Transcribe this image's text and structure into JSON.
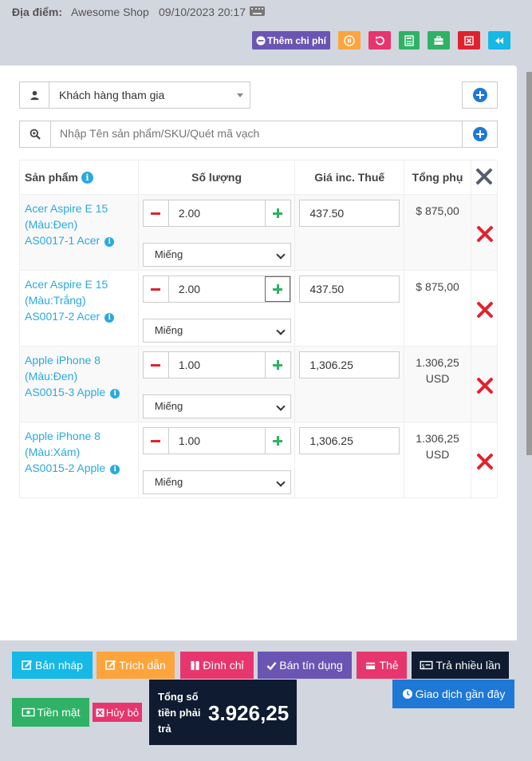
{
  "header": {
    "location_label": "Địa điểm:",
    "shop_name": "Awesome Shop",
    "datetime": "09/10/2023 20:17",
    "add_expense_label": "Thêm chi phí"
  },
  "customer": {
    "selected": "Khách hàng tham gia"
  },
  "search": {
    "placeholder": "Nhập Tên sản phẩm/SKU/Quét mã vạch"
  },
  "table": {
    "headers": {
      "product": "Sản phẩm",
      "quantity": "Số lượng",
      "price": "Giá inc. Thuế",
      "subtotal": "Tổng phụ"
    },
    "rows": [
      {
        "line1": "Acer Aspire E 15",
        "line2": "(Màu:Đen)",
        "line3": "AS0017-1 Acer",
        "qty": "2.00",
        "unit": "Miếng",
        "price": "437.50",
        "subtotal1": "$ 875,00",
        "subtotal2": ""
      },
      {
        "line1": "Acer Aspire E 15",
        "line2": "(Màu:Trắng)",
        "line3": "AS0017-2 Acer",
        "qty": "2.00",
        "unit": "Miếng",
        "price": "437.50",
        "subtotal1": "$ 875,00",
        "subtotal2": ""
      },
      {
        "line1": "Apple iPhone 8",
        "line2": "(Màu:Đen)",
        "line3": "AS0015-3 Apple",
        "qty": "1.00",
        "unit": "Miếng",
        "price": "1,306.25",
        "subtotal1": "1.306,25",
        "subtotal2": "USD"
      },
      {
        "line1": "Apple iPhone 8",
        "line2": "(Màu:Xám)",
        "line3": "AS0015-2 Apple",
        "qty": "1.00",
        "unit": "Miếng",
        "price": "1,306.25",
        "subtotal1": "1.306,25",
        "subtotal2": "USD"
      }
    ]
  },
  "footer": {
    "draft": "Bản nháp",
    "quote": "Trích dẫn",
    "suspend": "Đình chỉ",
    "credit_sale": "Bán tín dụng",
    "card": "Thẻ",
    "multi_pay": "Trả nhiều lần",
    "recent": "Giao dịch gần đây",
    "cash": "Tiền mặt",
    "cancel": "Hủy bỏ",
    "total_label": "Tổng số tiền phải trả",
    "total_value": "3.926,25"
  },
  "colors": {
    "purple": "#6a55b2",
    "orange": "#fda53c",
    "red": "#e0222f",
    "green": "#2fb266",
    "cyan": "#16b8e6",
    "pink": "#e7356e",
    "navy": "#0e1b30",
    "blue": "#1e78d6"
  }
}
